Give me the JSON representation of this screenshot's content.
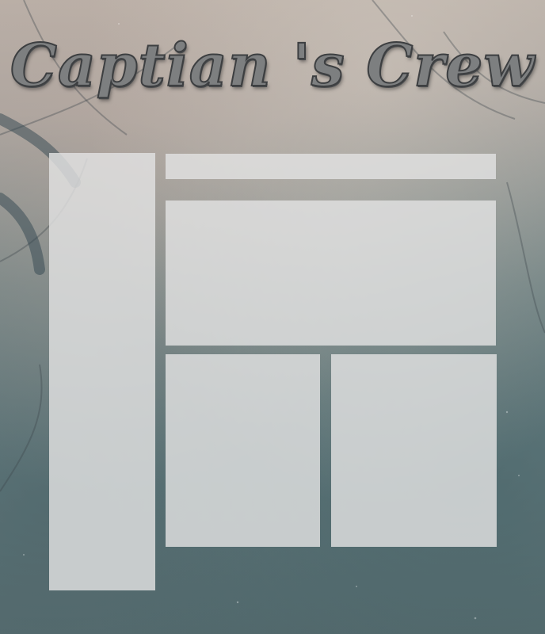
{
  "header": {
    "title": "Captian 's Crew"
  },
  "colors": {
    "panel": "#e2e2e2",
    "title_fill": "#7d7f80",
    "title_stroke": "#3d3f41",
    "background_top": "#b9b0a8",
    "background_bottom": "#5c7073"
  },
  "panels": {
    "sidebar": "",
    "top_bar": "",
    "main": "",
    "bottom_left": "",
    "bottom_right": ""
  }
}
